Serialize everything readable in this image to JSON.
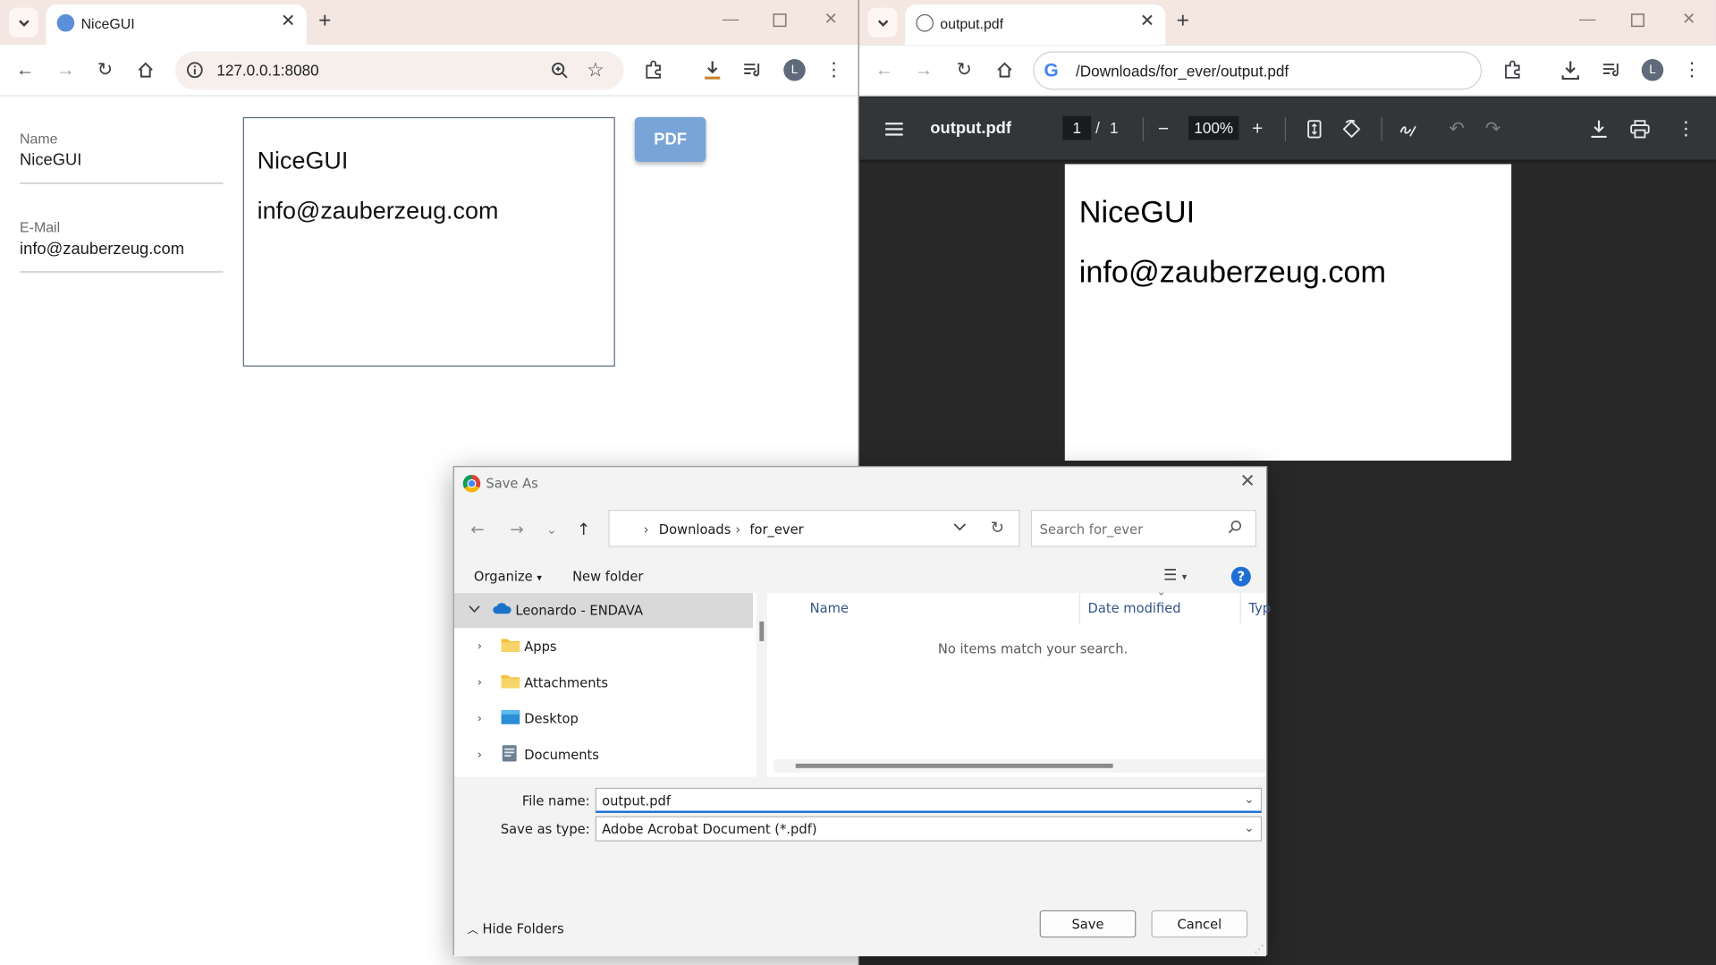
{
  "left_browser": {
    "tab_title": "NiceGUI",
    "url": "127.0.0.1:8080",
    "profile_initial": "L",
    "form": {
      "name_label": "Name",
      "name_value": "NiceGUI",
      "email_label": "E-Mail",
      "email_value": "info@zauberzeug.com"
    },
    "preview": {
      "line1": "NiceGUI",
      "line2": "info@zauberzeug.com"
    },
    "pdf_button": "PDF"
  },
  "right_browser": {
    "tab_title": "output.pdf",
    "url": "/Downloads/for_ever/output.pdf",
    "profile_initial": "L",
    "viewer": {
      "title": "output.pdf",
      "current_page": "1",
      "page_separator": "/",
      "total_pages": "1",
      "zoom": "100%"
    },
    "page_content": {
      "line1": "NiceGUI",
      "line2": "info@zauberzeug.com"
    }
  },
  "save_dialog": {
    "title": "Save As",
    "breadcrumb": [
      "Downloads",
      "for_ever"
    ],
    "search_placeholder": "Search for_ever",
    "organize_label": "Organize",
    "new_folder_label": "New folder",
    "help_label": "?",
    "nav_items": [
      {
        "label": "Leonardo - ENDAVA",
        "icon": "onedrive-cloud-icon"
      },
      {
        "label": "Apps",
        "icon": "folder-icon"
      },
      {
        "label": "Attachments",
        "icon": "folder-icon"
      },
      {
        "label": "Desktop",
        "icon": "desktop-folder-icon"
      },
      {
        "label": "Documents",
        "icon": "documents-folder-icon"
      }
    ],
    "columns": [
      "Name",
      "Date modified",
      "Typ"
    ],
    "empty_message": "No items match your search.",
    "file_name_label": "File name:",
    "file_name_value": "output.pdf",
    "save_type_label": "Save as type:",
    "save_type_value": "Adobe Acrobat Document (*.pdf)",
    "hide_folders_label": "Hide Folders",
    "save_button": "Save",
    "cancel_button": "Cancel"
  },
  "colors": {
    "tabstrip": "#f4e6e1",
    "pdf_button": "#78a4d8",
    "viewer_bg": "#282828",
    "viewer_toolbar": "#323639",
    "help_blue": "#1f6fd6",
    "folder_yellow": "#f3c13a",
    "onedrive_blue": "#1a73c9"
  }
}
